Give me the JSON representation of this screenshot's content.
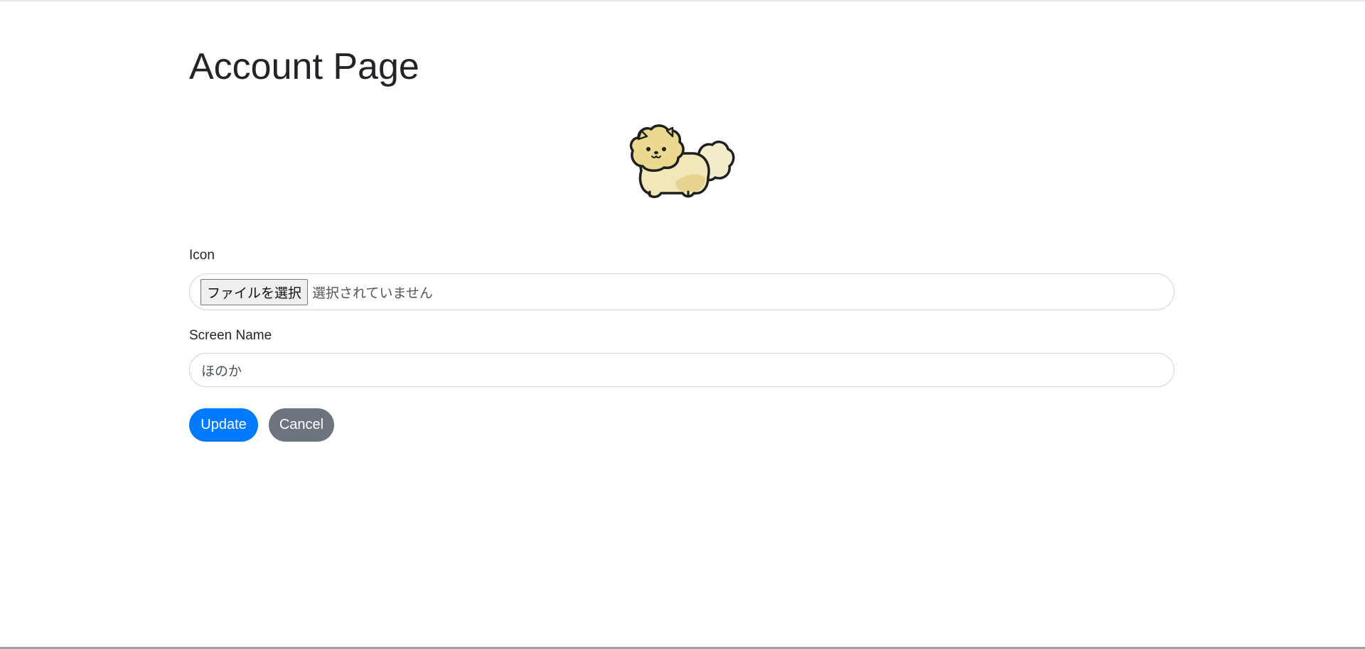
{
  "page": {
    "title": "Account Page"
  },
  "avatar": {
    "icon": "pomeranian-dog-avatar"
  },
  "form": {
    "icon_label": "Icon",
    "file_button_label": "ファイルを選択",
    "file_status": "選択されていません",
    "screen_name_label": "Screen Name",
    "screen_name_value": "ほのか"
  },
  "actions": {
    "update_label": "Update",
    "cancel_label": "Cancel"
  },
  "colors": {
    "primary": "#007bff",
    "secondary": "#6c757d",
    "border": "#ced4da",
    "text": "#212529"
  }
}
